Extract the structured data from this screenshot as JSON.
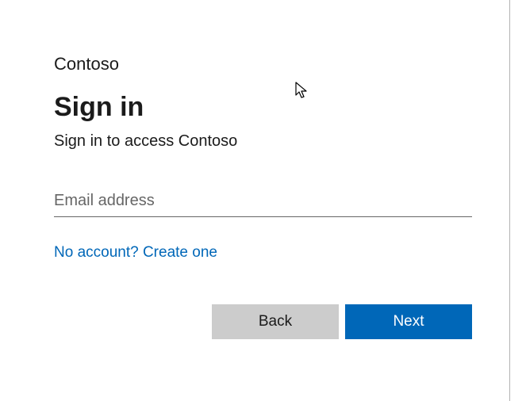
{
  "brand": "Contoso",
  "title": "Sign in",
  "subtext": "Sign in to access Contoso",
  "email": {
    "placeholder": "Email address",
    "value": ""
  },
  "links": {
    "create_account": "No account? Create one"
  },
  "buttons": {
    "back": "Back",
    "next": "Next"
  }
}
